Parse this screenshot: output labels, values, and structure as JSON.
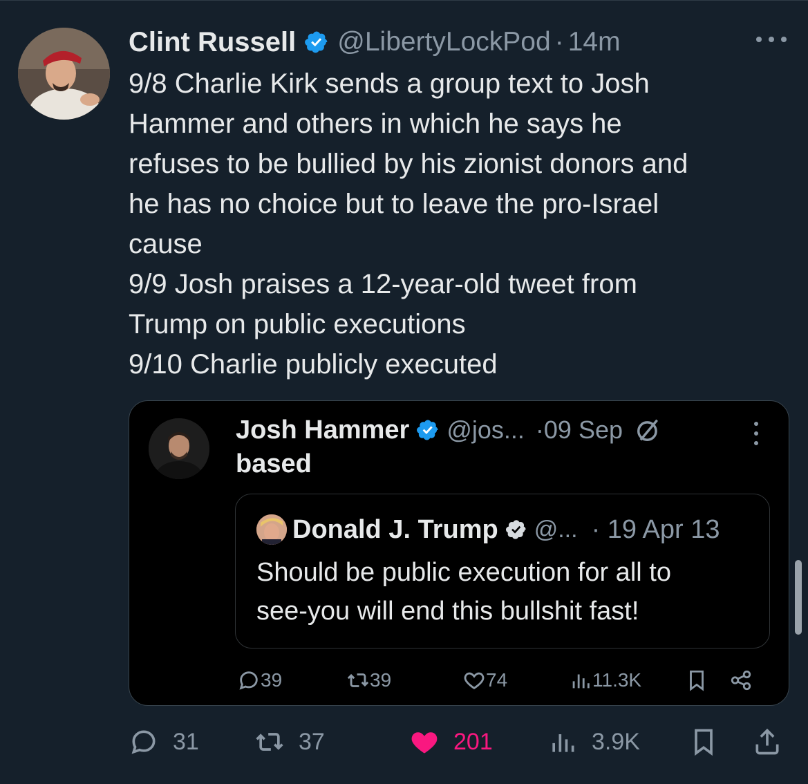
{
  "tweet": {
    "author_name": "Clint Russell",
    "handle": "@LibertyLockPod",
    "separator": "·",
    "time": "14m",
    "lines": [
      "9/8 Charlie Kirk sends a group text to Josh",
      "Hammer and others in which he says he",
      "refuses to be bullied by his zionist donors and",
      "he has no choice but to leave the pro-Israel",
      "cause",
      "9/9 Josh praises a 12-year-old tweet from",
      "Trump on public executions",
      "9/10 Charlie publicly executed"
    ],
    "stats": {
      "replies": "31",
      "reposts": "37",
      "likes": "201",
      "views": "3.9K"
    }
  },
  "quoted": {
    "author_name": "Josh Hammer",
    "handle": "@jos...",
    "date": "·09 Sep",
    "text": "based",
    "stats": {
      "replies": "39",
      "reposts": "39",
      "likes": "74",
      "views": "11.3K"
    }
  },
  "inner_quote": {
    "author_name": "Donald J. Trump",
    "handle": "@...",
    "date": "· 19 Apr 13",
    "lines": [
      "Should be public execution for all to",
      "see-you will end this bullshit fast!"
    ]
  },
  "colors": {
    "background": "#15202b",
    "verified": "#1d9bf0",
    "like": "#f91880",
    "muted": "#8b98a5"
  }
}
